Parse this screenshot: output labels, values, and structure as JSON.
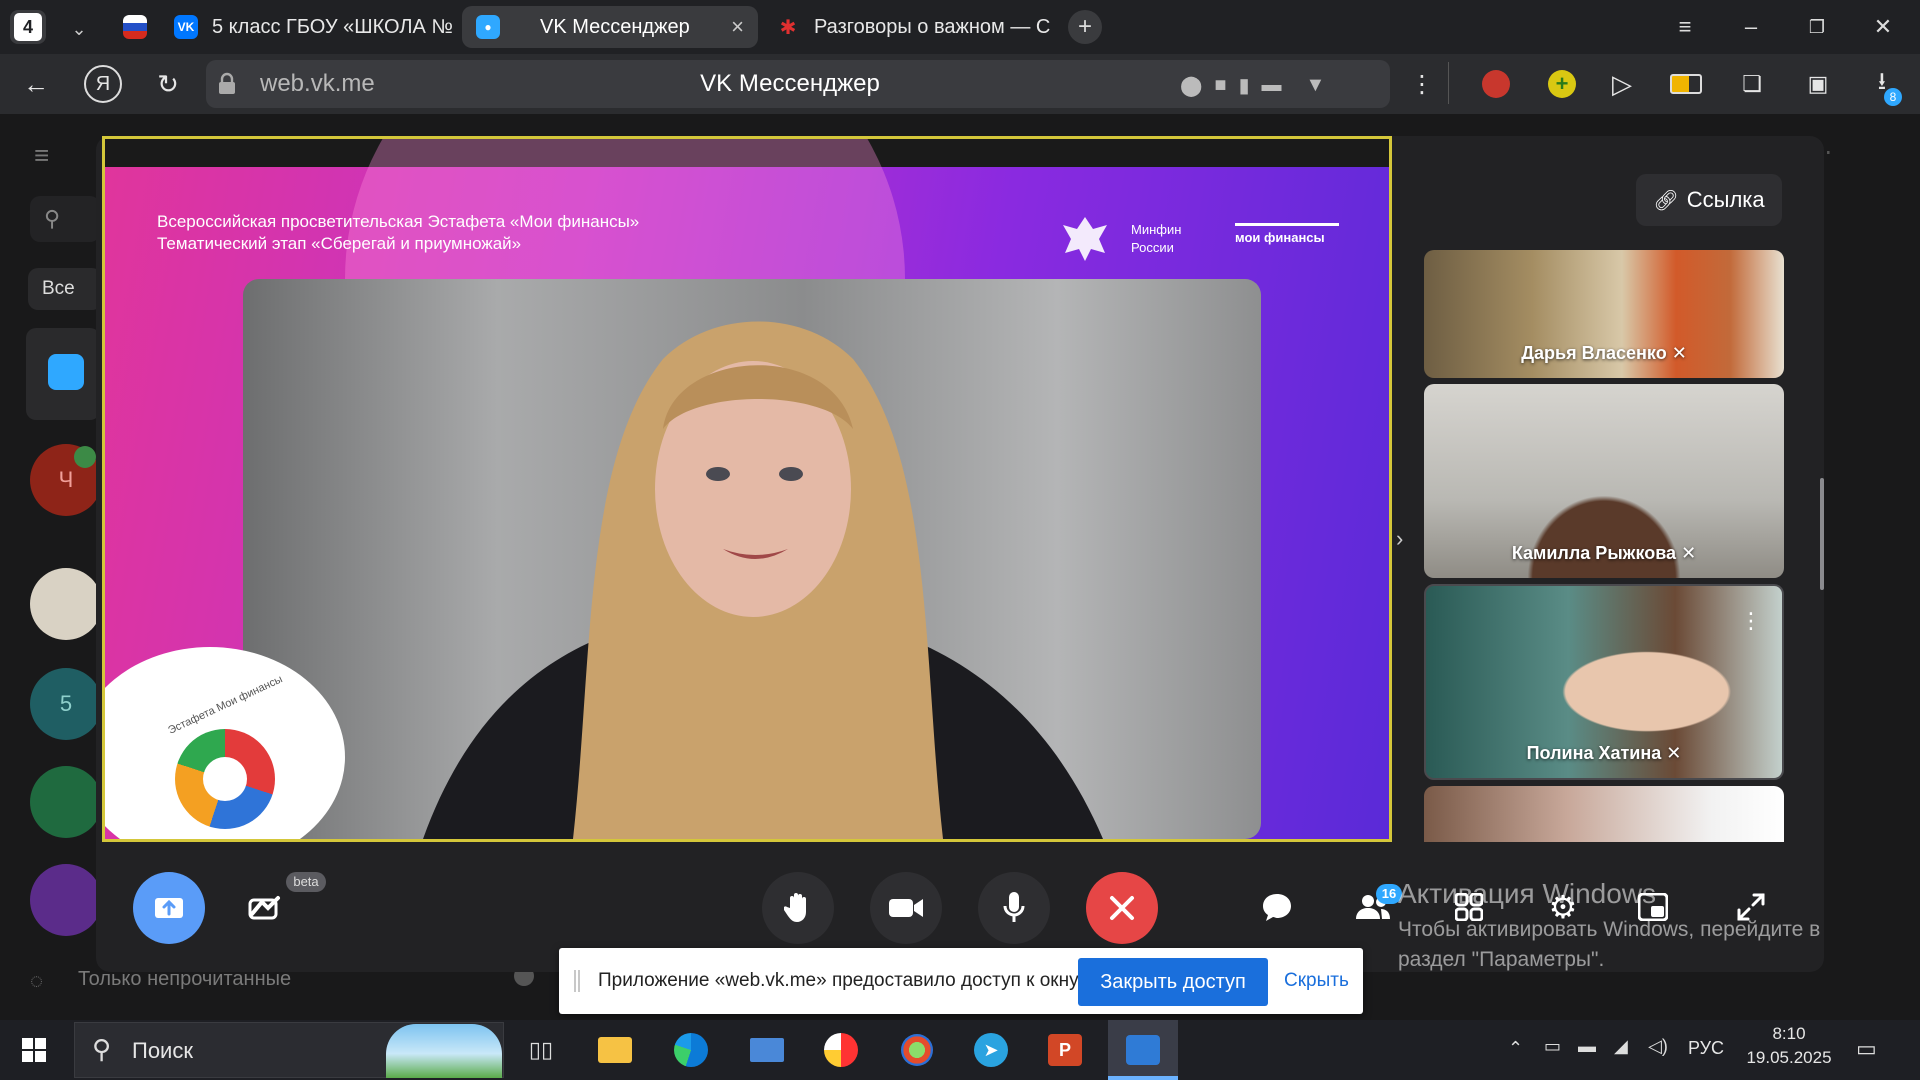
{
  "browser": {
    "tab_count": "4",
    "tabs": [
      {
        "label": ""
      },
      {
        "label": "5 класс ГБОУ «ШКОЛА №"
      },
      {
        "label": "VK Мессенджер"
      },
      {
        "label": "Разговоры о важном — С"
      }
    ],
    "url": "web.vk.me",
    "page_title": "VK Мессенджер"
  },
  "vk_sidebar": {
    "filter_all": "Все",
    "unread_only_label": "Только непрочитанные",
    "avatar_ch": "Ч",
    "avatar_5": "5"
  },
  "call": {
    "link_button": "Ссылка",
    "slide_title_line1": "Всероссийская просветительская Эстафета «Мои финансы»",
    "slide_title_line2": "Тематический этап «Сберегай и приумножай»",
    "ministry_line1": "Минфин",
    "ministry_line2": "России",
    "brand": "мои финансы",
    "logo_text": "Эстафета Мои финансы",
    "participants": [
      {
        "name": "Дарья Власенко"
      },
      {
        "name": "Камилла Рыжкова"
      },
      {
        "name": "Полина Хатина"
      }
    ],
    "beta_badge": "beta",
    "participants_count": "16",
    "controls": {
      "share": "upload-icon",
      "effects": "magic-hand-icon",
      "raise_hand": "hand-icon",
      "camera": "camera-icon",
      "mic": "mic-icon",
      "end": "end-call-icon",
      "chat": "chat-icon",
      "members": "people-icon",
      "grid": "grid-icon",
      "settings": "gear-icon",
      "pip": "pip-icon",
      "fullscreen": "expand-icon"
    },
    "end_color": "#e64646",
    "share_color": "#5a9cf8"
  },
  "share_notice": {
    "text": "Приложение «web.vk.me» предоставило доступ к окну.",
    "stop_button": "Закрыть доступ",
    "hide_link": "Скрыть"
  },
  "watermark": {
    "title": "Активация Windows",
    "line1": "Чтобы активировать Windows, перейдите в",
    "line2": "раздел \"Параметры\"."
  },
  "taskbar": {
    "search_placeholder": "Поиск",
    "language": "РУС",
    "time": "8:10",
    "date": "19.05.2025",
    "download_badge": "8"
  }
}
